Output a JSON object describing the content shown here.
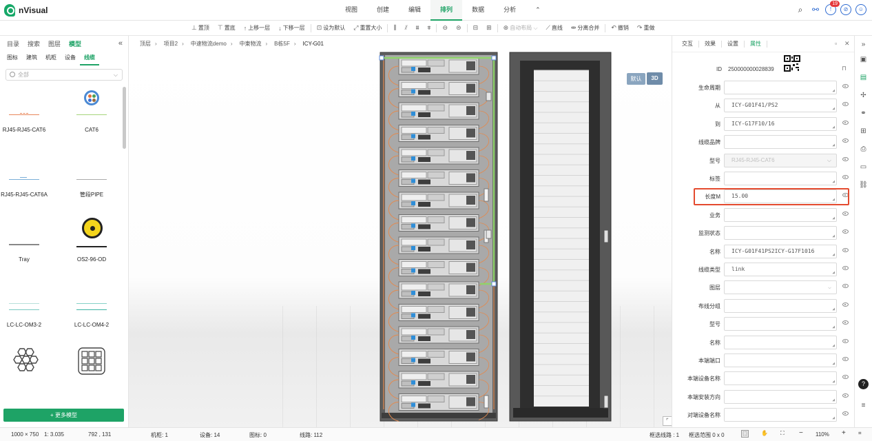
{
  "app": {
    "brand": "nVisual"
  },
  "menu": [
    "视图",
    "创建",
    "编辑",
    "排列",
    "数据",
    "分析",
    "⌃"
  ],
  "menu_active": 3,
  "topright": {
    "badge": "19"
  },
  "toolbar": [
    {
      "icon": "⊥",
      "label": "置顶"
    },
    {
      "icon": "⊤",
      "label": "置底"
    },
    {
      "icon": "↑",
      "label": "上移一层"
    },
    {
      "icon": "↓",
      "label": "下移一层"
    },
    {
      "icon": "⊡",
      "label": "设为默认"
    },
    {
      "icon": "⤢",
      "label": "重置大小"
    },
    {
      "icon": "⫼",
      "label": ""
    },
    {
      "icon": "⫽",
      "label": ""
    },
    {
      "icon": "⩩",
      "label": ""
    },
    {
      "icon": "⩨",
      "label": ""
    },
    {
      "icon": "⊖",
      "label": ""
    },
    {
      "icon": "⊜",
      "label": ""
    },
    {
      "icon": "⊟",
      "label": ""
    },
    {
      "icon": "⊞",
      "label": ""
    },
    {
      "icon": "⊛",
      "label": "自动布局 ⌵",
      "disabled": true
    },
    {
      "icon": "⟋",
      "label": "直线"
    },
    {
      "icon": "⇹",
      "label": "分离合并"
    },
    {
      "icon": "↶",
      "label": "撤销"
    },
    {
      "icon": "↷",
      "label": "重做"
    }
  ],
  "left": {
    "tabs": [
      "目录",
      "搜索",
      "图层",
      "模型"
    ],
    "tab_active": 3,
    "sub_tabs": [
      "图标",
      "建筑",
      "机柜",
      "设备",
      "线缆"
    ],
    "sub_active": 4,
    "search_placeholder": "全部",
    "models": [
      {
        "label": "RJ45-RJ45-CAT6",
        "kind": "line-orange"
      },
      {
        "label": "CAT6",
        "kind": "cable-blue"
      },
      {
        "label": "RJ45-RJ45-CAT6A",
        "kind": "line-blue"
      },
      {
        "label": "管段PIPE",
        "kind": "line-gray"
      },
      {
        "label": "Tray",
        "kind": "line-dark"
      },
      {
        "label": "OS2-96-OD",
        "kind": "cable-yellow"
      },
      {
        "label": "LC-LC-OM3-2",
        "kind": "line-teal"
      },
      {
        "label": "LC-LC-OM4-2",
        "kind": "line-teal2"
      },
      {
        "label": "",
        "kind": "hex-grid"
      },
      {
        "label": "",
        "kind": "square-grid"
      }
    ],
    "more_button": "+ 更多模型"
  },
  "breadcrumb": [
    "顶层",
    "项目2",
    "中速物流demo",
    "中東物流",
    "B栋5F",
    "ICY-G01"
  ],
  "canvas": {
    "view_default": "默认",
    "view_3d": "3D"
  },
  "right": {
    "tabs": [
      "属性",
      "设置",
      "效果",
      "交互"
    ],
    "id_label": "ID",
    "id_value": "250000000028839",
    "rows": [
      {
        "label": "生命周期",
        "value": ""
      },
      {
        "label": "从",
        "value": "ICY-G01F41/PS2"
      },
      {
        "label": "到",
        "value": "ICY-G17F10/16"
      },
      {
        "label": "线缆品牌",
        "value": ""
      },
      {
        "label": "型号",
        "value": "RJ45-RJ45-CAT6",
        "disabled": true,
        "dropdown": true
      },
      {
        "label": "标签",
        "value": ""
      },
      {
        "label": "长度M",
        "value": "15.00"
      },
      {
        "label": "业务",
        "value": ""
      },
      {
        "label": "监测状态",
        "value": ""
      },
      {
        "label": "名称",
        "value": "ICY-G01F41PS2ICY-G17F1016"
      },
      {
        "label": "线缆类型",
        "value": "link"
      },
      {
        "label": "图层",
        "value": "",
        "dropdown": true
      },
      {
        "label": "布线分组",
        "value": ""
      },
      {
        "label": "型号",
        "value": ""
      },
      {
        "label": "名称",
        "value": ""
      },
      {
        "label": "本端端口",
        "value": ""
      },
      {
        "label": "本端设备名称",
        "value": ""
      },
      {
        "label": "本端安装方向",
        "value": ""
      },
      {
        "label": "对端设备名称",
        "value": ""
      }
    ]
  },
  "status": {
    "size": "1000 × 750",
    "scale": "1: 3.035",
    "coords": "792 , 131",
    "cabinets": "机柜: 1",
    "devices": "设备: 14",
    "icons": "图标: 0",
    "lines": "线路: 112",
    "selected_lines": "框选线路 : 1",
    "selected_range": "框选范围 0 x 0",
    "zoom": "110%"
  }
}
